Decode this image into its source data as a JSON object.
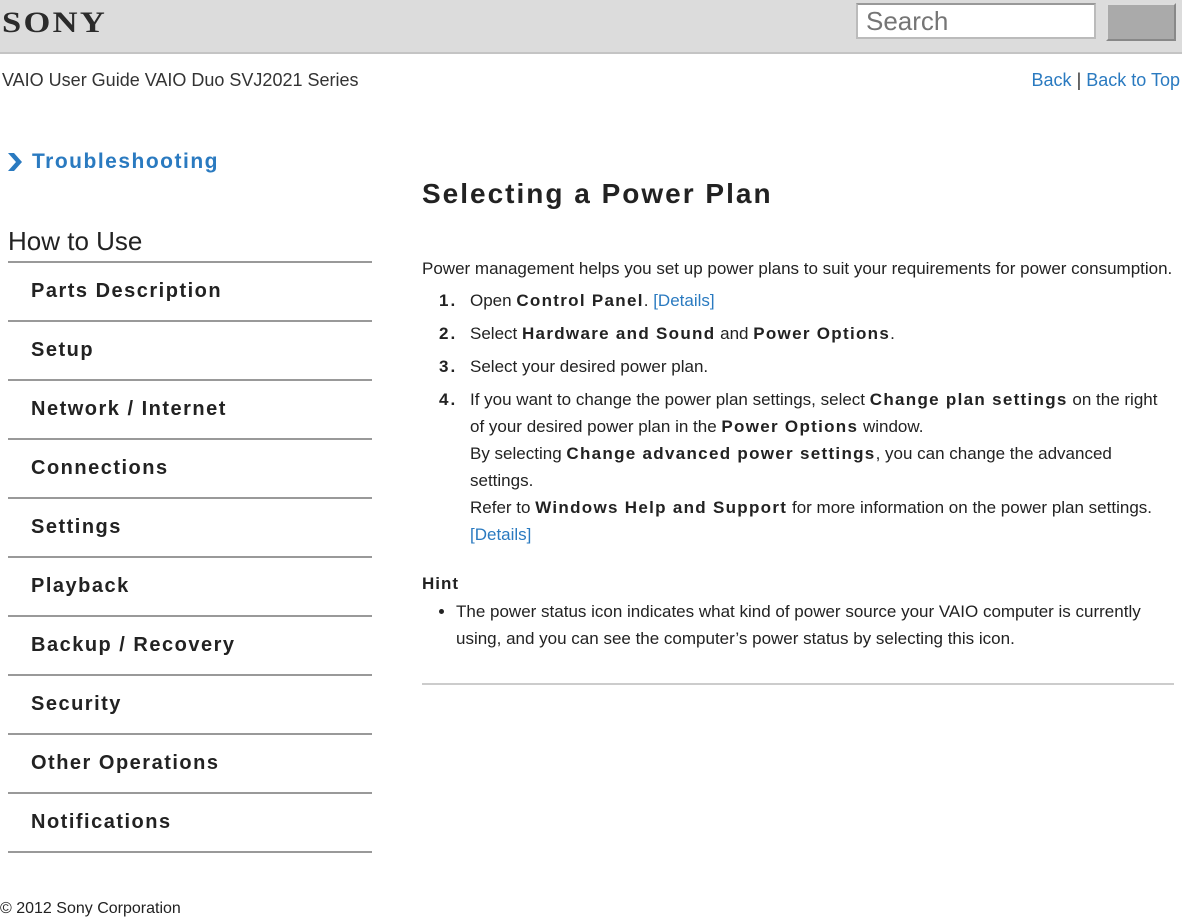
{
  "header": {
    "logo": "SONY",
    "search_placeholder": "Search",
    "guide_title": "VAIO User Guide VAIO Duo SVJ2021 Series",
    "back_label": "Back",
    "separator": "|",
    "back_to_top_label": "Back to Top"
  },
  "sidebar": {
    "troubleshooting_label": "Troubleshooting",
    "section_title": "How to Use",
    "items": [
      {
        "label": "Parts Description"
      },
      {
        "label": "Setup"
      },
      {
        "label": "Network / Internet"
      },
      {
        "label": "Connections"
      },
      {
        "label": "Settings"
      },
      {
        "label": "Playback"
      },
      {
        "label": "Backup / Recovery"
      },
      {
        "label": "Security"
      },
      {
        "label": "Other Operations"
      },
      {
        "label": "Notifications"
      }
    ]
  },
  "main": {
    "title": "Selecting a Power Plan",
    "intro": "Power management helps you set up power plans to suit your requirements for power consumption.",
    "steps": [
      {
        "num": "1.",
        "t1": "Open ",
        "b1": "Control Panel",
        "t2": ". ",
        "link": "[Details]"
      },
      {
        "num": "2.",
        "t1": "Select ",
        "b1": "Hardware and Sound",
        "t2": " and ",
        "b2": "Power Options",
        "t3": "."
      },
      {
        "num": "3.",
        "t1": "Select your desired power plan."
      },
      {
        "num": "4.",
        "t1": "If you want to change the power plan settings, select ",
        "b1": "Change plan settings",
        "t2": " on the right of your desired power plan in the ",
        "b2": "Power Options",
        "t3": " window.",
        "t4": "By selecting ",
        "b3": "Change advanced power settings",
        "t5": ", you can change the advanced settings.",
        "t6": "Refer to ",
        "b4": "Windows Help and Support",
        "t7": " for more information on the power plan settings. ",
        "link": "[Details]"
      }
    ],
    "hint_title": "Hint",
    "hint_items": [
      "The power status icon indicates what kind of power source your VAIO computer is currently using, and you can see the computer’s power status by selecting this icon."
    ]
  },
  "footer": {
    "copyright": "© 2012 Sony Corporation"
  },
  "colors": {
    "link": "#2a7ac0",
    "header_bg": "#dcdcdc"
  }
}
